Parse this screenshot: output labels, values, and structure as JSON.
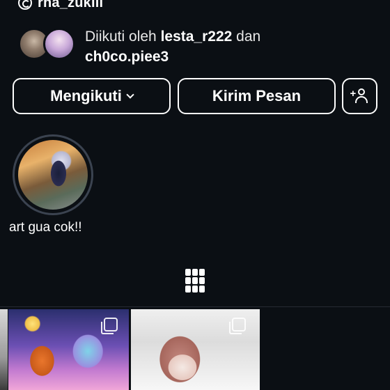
{
  "profile": {
    "threads_username": "rha_zukiii"
  },
  "followed_by": {
    "prefix": "Diikuti oleh",
    "user1": "lesta_r222",
    "conjunction": "dan",
    "user2": "ch0co.piee3"
  },
  "actions": {
    "follow_label": "Mengikuti",
    "message_label": "Kirim Pesan",
    "add_user_icon": "add-person-icon"
  },
  "highlights": [
    {
      "label": "art gua cok!!"
    }
  ],
  "tabs": {
    "active": "grid-icon"
  },
  "posts": [
    {
      "icon": "multi-post-icon"
    },
    {
      "icon": "multi-post-icon"
    }
  ],
  "colors": {
    "background": "#0b0f14",
    "text": "#ffffff",
    "highlight_ring": "#3b4350"
  }
}
